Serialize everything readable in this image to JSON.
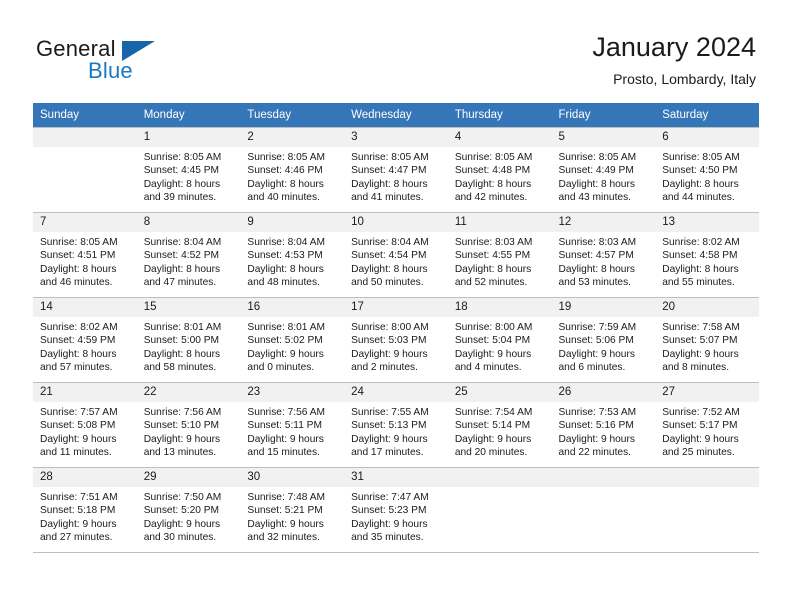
{
  "brand": {
    "word1": "General",
    "word2": "Blue",
    "logo_icon": "triangle-logo-icon",
    "accent_color": "#1878c4"
  },
  "header": {
    "title": "January 2024",
    "subtitle": "Prosto, Lombardy, Italy"
  },
  "calendar": {
    "header_bg": "#3476b7",
    "daynum_bg": "#f1f1f1",
    "weekdays": [
      "Sunday",
      "Monday",
      "Tuesday",
      "Wednesday",
      "Thursday",
      "Friday",
      "Saturday"
    ],
    "weeks": [
      [
        {
          "day": "",
          "lines": []
        },
        {
          "day": "1",
          "lines": [
            "Sunrise: 8:05 AM",
            "Sunset: 4:45 PM",
            "Daylight: 8 hours",
            "and 39 minutes."
          ]
        },
        {
          "day": "2",
          "lines": [
            "Sunrise: 8:05 AM",
            "Sunset: 4:46 PM",
            "Daylight: 8 hours",
            "and 40 minutes."
          ]
        },
        {
          "day": "3",
          "lines": [
            "Sunrise: 8:05 AM",
            "Sunset: 4:47 PM",
            "Daylight: 8 hours",
            "and 41 minutes."
          ]
        },
        {
          "day": "4",
          "lines": [
            "Sunrise: 8:05 AM",
            "Sunset: 4:48 PM",
            "Daylight: 8 hours",
            "and 42 minutes."
          ]
        },
        {
          "day": "5",
          "lines": [
            "Sunrise: 8:05 AM",
            "Sunset: 4:49 PM",
            "Daylight: 8 hours",
            "and 43 minutes."
          ]
        },
        {
          "day": "6",
          "lines": [
            "Sunrise: 8:05 AM",
            "Sunset: 4:50 PM",
            "Daylight: 8 hours",
            "and 44 minutes."
          ]
        }
      ],
      [
        {
          "day": "7",
          "lines": [
            "Sunrise: 8:05 AM",
            "Sunset: 4:51 PM",
            "Daylight: 8 hours",
            "and 46 minutes."
          ]
        },
        {
          "day": "8",
          "lines": [
            "Sunrise: 8:04 AM",
            "Sunset: 4:52 PM",
            "Daylight: 8 hours",
            "and 47 minutes."
          ]
        },
        {
          "day": "9",
          "lines": [
            "Sunrise: 8:04 AM",
            "Sunset: 4:53 PM",
            "Daylight: 8 hours",
            "and 48 minutes."
          ]
        },
        {
          "day": "10",
          "lines": [
            "Sunrise: 8:04 AM",
            "Sunset: 4:54 PM",
            "Daylight: 8 hours",
            "and 50 minutes."
          ]
        },
        {
          "day": "11",
          "lines": [
            "Sunrise: 8:03 AM",
            "Sunset: 4:55 PM",
            "Daylight: 8 hours",
            "and 52 minutes."
          ]
        },
        {
          "day": "12",
          "lines": [
            "Sunrise: 8:03 AM",
            "Sunset: 4:57 PM",
            "Daylight: 8 hours",
            "and 53 minutes."
          ]
        },
        {
          "day": "13",
          "lines": [
            "Sunrise: 8:02 AM",
            "Sunset: 4:58 PM",
            "Daylight: 8 hours",
            "and 55 minutes."
          ]
        }
      ],
      [
        {
          "day": "14",
          "lines": [
            "Sunrise: 8:02 AM",
            "Sunset: 4:59 PM",
            "Daylight: 8 hours",
            "and 57 minutes."
          ]
        },
        {
          "day": "15",
          "lines": [
            "Sunrise: 8:01 AM",
            "Sunset: 5:00 PM",
            "Daylight: 8 hours",
            "and 58 minutes."
          ]
        },
        {
          "day": "16",
          "lines": [
            "Sunrise: 8:01 AM",
            "Sunset: 5:02 PM",
            "Daylight: 9 hours",
            "and 0 minutes."
          ]
        },
        {
          "day": "17",
          "lines": [
            "Sunrise: 8:00 AM",
            "Sunset: 5:03 PM",
            "Daylight: 9 hours",
            "and 2 minutes."
          ]
        },
        {
          "day": "18",
          "lines": [
            "Sunrise: 8:00 AM",
            "Sunset: 5:04 PM",
            "Daylight: 9 hours",
            "and 4 minutes."
          ]
        },
        {
          "day": "19",
          "lines": [
            "Sunrise: 7:59 AM",
            "Sunset: 5:06 PM",
            "Daylight: 9 hours",
            "and 6 minutes."
          ]
        },
        {
          "day": "20",
          "lines": [
            "Sunrise: 7:58 AM",
            "Sunset: 5:07 PM",
            "Daylight: 9 hours",
            "and 8 minutes."
          ]
        }
      ],
      [
        {
          "day": "21",
          "lines": [
            "Sunrise: 7:57 AM",
            "Sunset: 5:08 PM",
            "Daylight: 9 hours",
            "and 11 minutes."
          ]
        },
        {
          "day": "22",
          "lines": [
            "Sunrise: 7:56 AM",
            "Sunset: 5:10 PM",
            "Daylight: 9 hours",
            "and 13 minutes."
          ]
        },
        {
          "day": "23",
          "lines": [
            "Sunrise: 7:56 AM",
            "Sunset: 5:11 PM",
            "Daylight: 9 hours",
            "and 15 minutes."
          ]
        },
        {
          "day": "24",
          "lines": [
            "Sunrise: 7:55 AM",
            "Sunset: 5:13 PM",
            "Daylight: 9 hours",
            "and 17 minutes."
          ]
        },
        {
          "day": "25",
          "lines": [
            "Sunrise: 7:54 AM",
            "Sunset: 5:14 PM",
            "Daylight: 9 hours",
            "and 20 minutes."
          ]
        },
        {
          "day": "26",
          "lines": [
            "Sunrise: 7:53 AM",
            "Sunset: 5:16 PM",
            "Daylight: 9 hours",
            "and 22 minutes."
          ]
        },
        {
          "day": "27",
          "lines": [
            "Sunrise: 7:52 AM",
            "Sunset: 5:17 PM",
            "Daylight: 9 hours",
            "and 25 minutes."
          ]
        }
      ],
      [
        {
          "day": "28",
          "lines": [
            "Sunrise: 7:51 AM",
            "Sunset: 5:18 PM",
            "Daylight: 9 hours",
            "and 27 minutes."
          ]
        },
        {
          "day": "29",
          "lines": [
            "Sunrise: 7:50 AM",
            "Sunset: 5:20 PM",
            "Daylight: 9 hours",
            "and 30 minutes."
          ]
        },
        {
          "day": "30",
          "lines": [
            "Sunrise: 7:48 AM",
            "Sunset: 5:21 PM",
            "Daylight: 9 hours",
            "and 32 minutes."
          ]
        },
        {
          "day": "31",
          "lines": [
            "Sunrise: 7:47 AM",
            "Sunset: 5:23 PM",
            "Daylight: 9 hours",
            "and 35 minutes."
          ]
        },
        {
          "day": "",
          "lines": []
        },
        {
          "day": "",
          "lines": []
        },
        {
          "day": "",
          "lines": []
        }
      ]
    ]
  }
}
